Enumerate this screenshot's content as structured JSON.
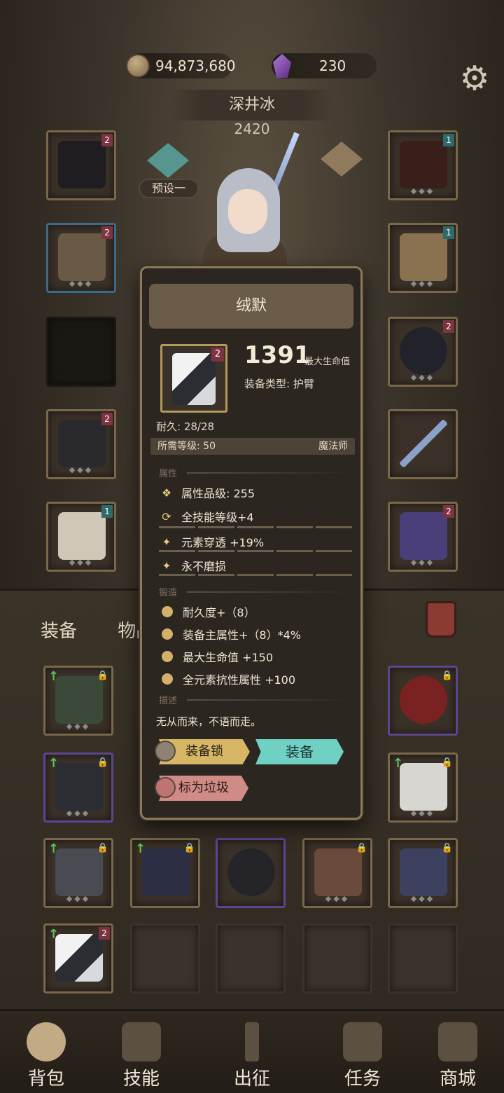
{
  "top_bar": {
    "gold": "94,873,680",
    "gems": "230"
  },
  "character": {
    "name": "深井冰",
    "power": "2420",
    "preset_label": "预设一"
  },
  "tabs": {
    "equipment": "装备",
    "items": "物品"
  },
  "tooltip": {
    "title": "绒默",
    "tier": "2",
    "main_stat_value": "1391",
    "main_stat_label": "最大生命值",
    "equip_type_label": "装备类型:",
    "equip_type_value": "护臂",
    "durability": "耐久: 28/28",
    "required_level_label": "所需等级: 50",
    "class_label": "魔法师",
    "attributes_header": "属性",
    "attributes": [
      {
        "icon": "quality-icon",
        "text": "属性品级: 255"
      },
      {
        "icon": "refresh-icon",
        "text": "全技能等级+4"
      },
      {
        "icon": "sparkle-icon",
        "text": "元素穿透 +19%"
      },
      {
        "icon": "sparkle-icon",
        "text": "永不磨损"
      }
    ],
    "forge_header": "锻造",
    "forge": [
      "耐久度+（8）",
      "装备主属性+（8）*4%",
      "最大生命值 +150",
      "全元素抗性属性 +100"
    ],
    "description_header": "描述",
    "description": "无从而来，不语而走。",
    "buttons": {
      "lock": "装备锁",
      "equip": "装备",
      "trash": "标为垃圾"
    }
  },
  "equipped_slots": {
    "left": [
      {
        "name": "cage-helm",
        "tier": "2",
        "border": "gold"
      },
      {
        "name": "cloak-armor",
        "tier": "2",
        "border": "blue"
      },
      {
        "name": "empty-slot",
        "tier": "",
        "border": "empty"
      },
      {
        "name": "pants",
        "tier": "2",
        "border": "gold"
      },
      {
        "name": "boots",
        "tier": "1",
        "border": "gold"
      }
    ],
    "right": [
      {
        "name": "ruby-amulet",
        "tier": "1",
        "border": "gold"
      },
      {
        "name": "owl-trinket",
        "tier": "1",
        "border": "gold"
      },
      {
        "name": "dark-ring",
        "tier": "2",
        "border": "gold"
      },
      {
        "name": "staff",
        "tier": "",
        "border": "gold"
      },
      {
        "name": "rose-offhand",
        "tier": "2",
        "border": "gold"
      }
    ]
  },
  "bottom_nav": [
    {
      "label": "背包",
      "icon": "backpack-icon"
    },
    {
      "label": "技能",
      "icon": "skill-book-icon"
    },
    {
      "label": "出征",
      "icon": "sword-icon"
    },
    {
      "label": "任务",
      "icon": "quest-scroll-icon"
    },
    {
      "label": "商城",
      "icon": "shop-crown-icon"
    }
  ],
  "colors": {
    "panel_bg": "#2b2620",
    "panel_border": "#8e7a58",
    "equip_button": "#6fd1c4",
    "lock_button": "#d7b766",
    "trash_button": "#d08b86"
  }
}
